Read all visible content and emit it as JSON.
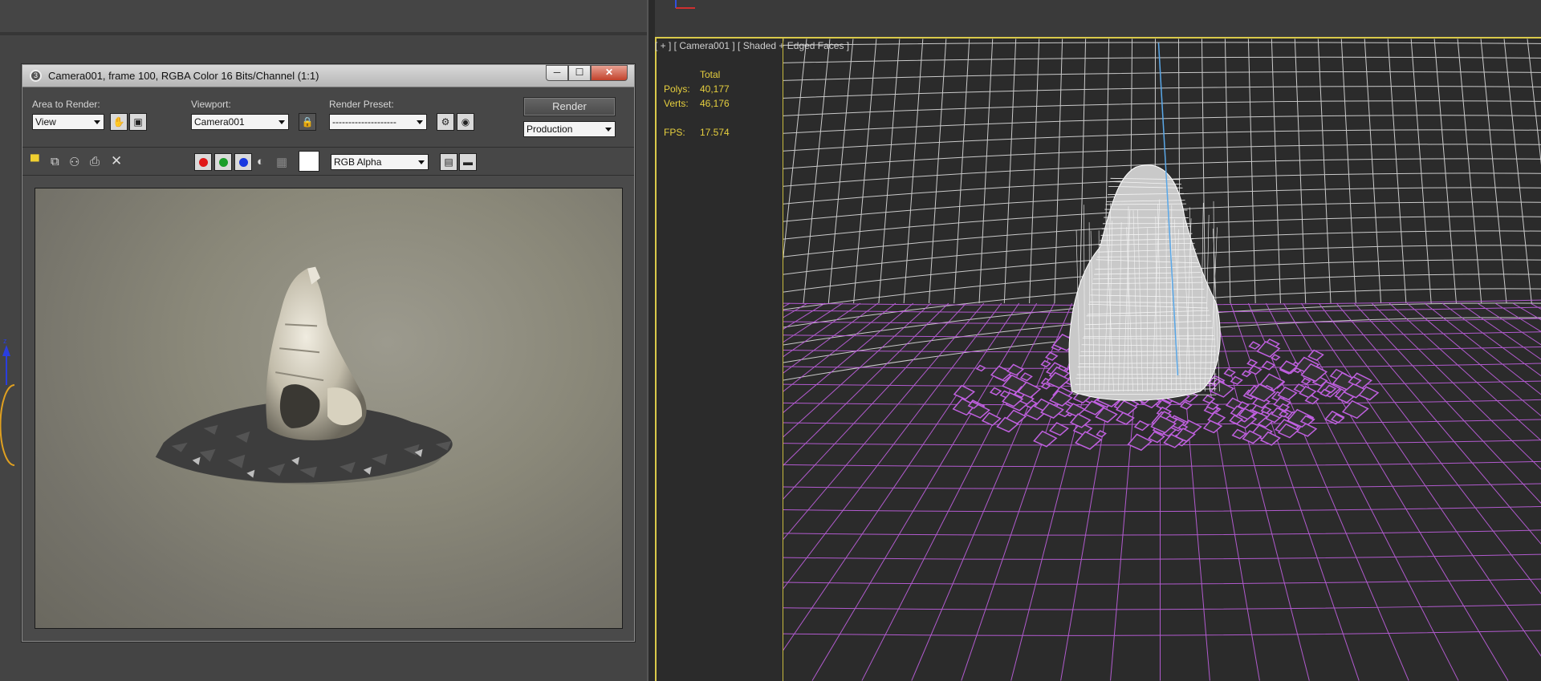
{
  "render_window": {
    "title": "Camera001, frame 100, RGBA Color 16 Bits/Channel (1:1)",
    "controls": {
      "minimize": "─",
      "maximize": "☐",
      "close": "✕"
    },
    "area_to_render": {
      "label": "Area to Render:",
      "value": "View"
    },
    "viewport": {
      "label": "Viewport:",
      "value": "Camera001"
    },
    "render_preset": {
      "label": "Render Preset:",
      "value": "--------------------"
    },
    "render_button": "Render",
    "production": {
      "value": "Production"
    },
    "channel_display": {
      "value": "RGB Alpha"
    },
    "channel_colors": {
      "red": "#e01818",
      "green": "#1a9e2a",
      "blue": "#1838e0"
    }
  },
  "viewport": {
    "label": "[ + ] [ Camera001 ] [ Shaded + Edged Faces ]",
    "stats": {
      "header": "Total",
      "polys_label": "Polys:",
      "polys_value": "40,177",
      "verts_label": "Verts:",
      "verts_value": "46,176",
      "fps_label": "FPS:",
      "fps_value": "17.574"
    },
    "colors": {
      "active_border": "#d9c94a",
      "selection_wire": "#c060e0",
      "grid": "#ffffff"
    }
  }
}
